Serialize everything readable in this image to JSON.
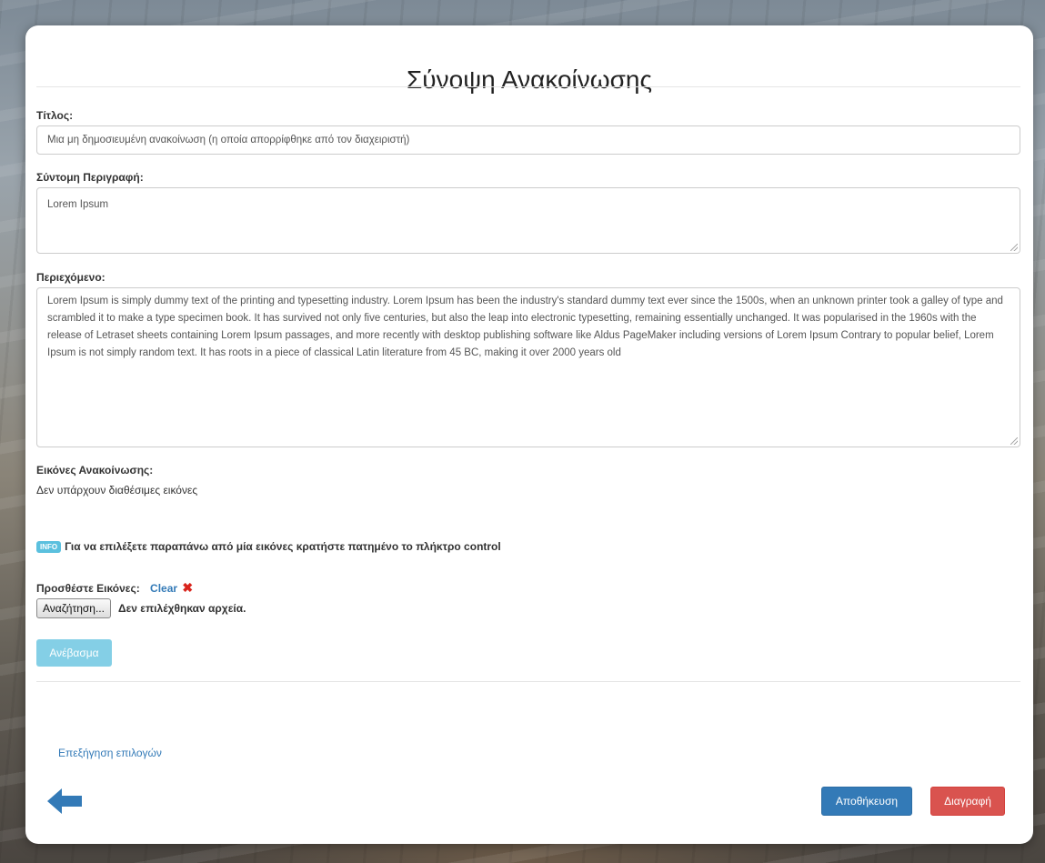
{
  "page": {
    "title": "Σύνοψη Ανακοίνωσης"
  },
  "form": {
    "title_label": "Τίτλος:",
    "title_value": "Μια μη δημοσιευμένη ανακοίνωση (η οποία απορρίφθηκε από τον διαχειριστή)",
    "short_desc_label": "Σύντομη Περιγραφή:",
    "short_desc_value": "Lorem Ipsum",
    "content_label": "Περιεχόμενο:",
    "content_value": "Lorem Ipsum is simply dummy text of the printing and typesetting industry. Lorem Ipsum has been the industry's standard dummy text ever since the 1500s, when an unknown printer took a galley of type and scrambled it to make a type specimen book. It has survived not only five centuries, but also the leap into electronic typesetting, remaining essentially unchanged. It was popularised in the 1960s with the release of Letraset sheets containing Lorem Ipsum passages, and more recently with desktop publishing software like Aldus PageMaker including versions of Lorem Ipsum Contrary to popular belief, Lorem Ipsum is not simply random text. It has roots in a piece of classical Latin literature from 45 BC, making it over 2000 years old"
  },
  "images": {
    "label": "Εικόνες Ανακοίνωσης:",
    "empty_text": "Δεν υπάρχουν διαθέσιμες εικόνες",
    "info_badge": "INFO",
    "info_text": "Για να επιλέξετε παραπάνω από μία εικόνες κρατήστε πατημένο το πλήκτρο control",
    "add_label": "Προσθέστε Εικόνες:",
    "clear_label": "Clear",
    "clear_icon": "close-x-icon",
    "browse_label": "Αναζήτηση...",
    "no_files_text": "Δεν επιλέχθηκαν αρχεία.",
    "upload_label": "Ανέβασμα"
  },
  "footer": {
    "help_link": "Επεξήγηση επιλογών",
    "back_icon": "arrow-left-icon",
    "save_label": "Αποθήκευση",
    "delete_label": "Διαγραφή"
  },
  "colors": {
    "primary": "#337ab7",
    "danger": "#d9534f",
    "info": "#5bc0de"
  }
}
